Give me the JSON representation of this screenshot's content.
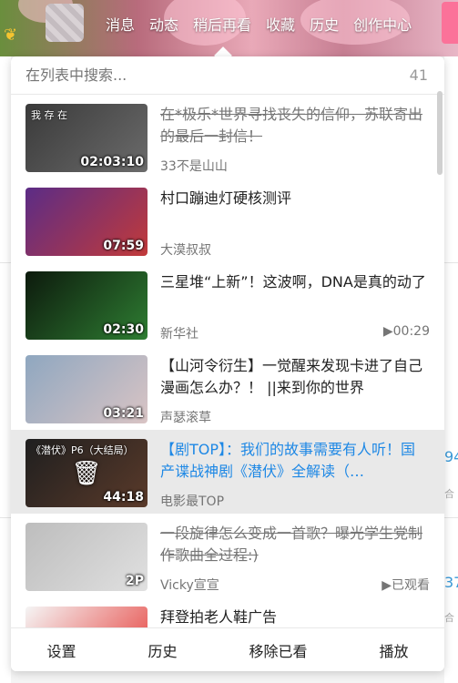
{
  "nav": {
    "items": [
      "消息",
      "动态",
      "稍后再看",
      "收藏",
      "历史",
      "创作中心"
    ]
  },
  "search": {
    "placeholder": "在列表中搜索...",
    "count": "41"
  },
  "videos": [
    {
      "title": "在*极乐*世界寻找丧失的信仰，苏联寄出的最后一封信！",
      "author": "33不是山山",
      "duration": "02:03:10",
      "status": "",
      "state": "strike",
      "thumb_label": "我 存 在",
      "thumb_colors": [
        "#3a3a3a",
        "#6b6b6b"
      ]
    },
    {
      "title": "村口蹦迪灯硬核测评",
      "author": "大漠叔叔",
      "duration": "07:59",
      "status": "",
      "state": "normal",
      "thumb_label": "",
      "thumb_colors": [
        "#5b2c86",
        "#c23a3a"
      ]
    },
    {
      "title": "三星堆“上新”！这波啊，DNA是真的动了",
      "author": "新华社",
      "duration": "02:30",
      "status": "▶00:29",
      "state": "normal",
      "thumb_label": "",
      "thumb_colors": [
        "#0d1a0d",
        "#2e7d32"
      ]
    },
    {
      "title": "【山河令衍生】一觉醒来发现卡进了自己漫画怎么办？！ ||来到你的世界",
      "author": "声瑟滚草",
      "duration": "03:21",
      "status": "",
      "state": "normal",
      "thumb_label": "",
      "thumb_colors": [
        "#8fa7c0",
        "#d9c4c4"
      ]
    },
    {
      "title": "【剧TOP】：我们的故事需要有人听！国产谍战神剧《潜伏》全解读（…",
      "author": "电影最TOP",
      "duration": "44:18",
      "status": "",
      "state": "active",
      "thumb_label": "《潜伏》P6（大结局）",
      "thumb_colors": [
        "#1f1f1f",
        "#5a3a2a"
      ]
    },
    {
      "title": "一段旋律怎么变成一首歌？曝光学生党制作歌曲全过程:)",
      "author": "Vicky宣宣",
      "duration": "2P",
      "status": "▶已观看",
      "state": "strike",
      "thumb_label": "",
      "thumb_colors": [
        "#bdbdbd",
        "#e0e0e0"
      ]
    },
    {
      "title": "拜登拍老人鞋广告",
      "author": "",
      "duration": "",
      "status": "",
      "state": "normal",
      "thumb_label": "",
      "thumb_colors": [
        "#f5f5f5",
        "#e53935"
      ]
    }
  ],
  "footer": {
    "settings": "设置",
    "history": "历史",
    "remove_watched": "移除已看",
    "play": "播放"
  },
  "background": {
    "right_num_1": "94",
    "right_sub_1": "合",
    "right_num_2": "37",
    "right_sub_2": "合"
  },
  "colors": {
    "accent_blue": "#1e88e5",
    "pink": "#fb7299"
  }
}
